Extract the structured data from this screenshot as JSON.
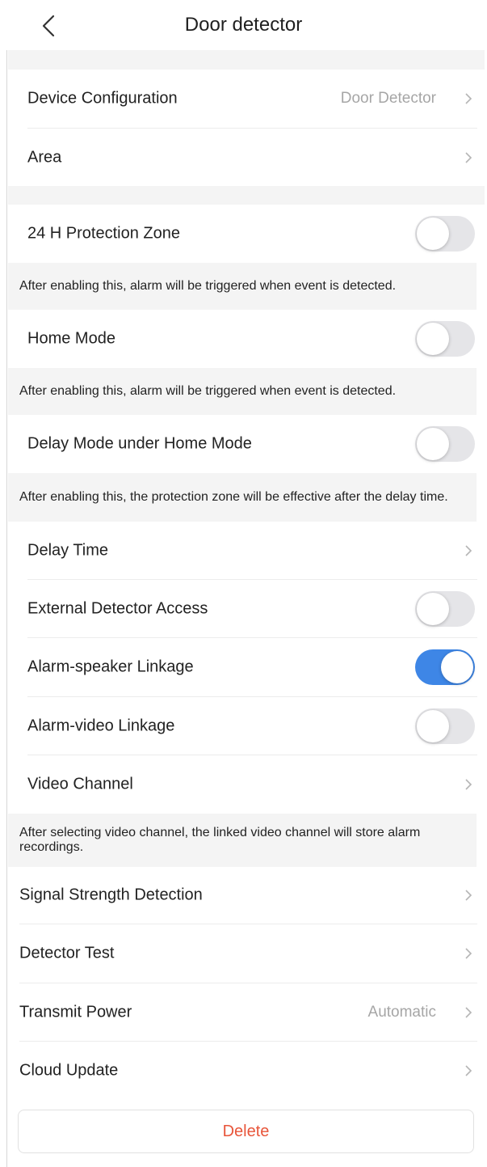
{
  "header": {
    "title": "Door detector"
  },
  "items": {
    "device_config": {
      "label": "Device Configuration",
      "value": "Door Detector"
    },
    "area": {
      "label": "Area"
    },
    "protection_24h": {
      "label": "24 H Protection Zone",
      "enabled": false
    },
    "home_mode": {
      "label": "Home Mode",
      "enabled": false
    },
    "delay_mode": {
      "label": "Delay Mode under Home Mode",
      "enabled": false
    },
    "delay_time": {
      "label": "Delay Time"
    },
    "external_detector": {
      "label": "External Detector Access",
      "enabled": false
    },
    "alarm_speaker": {
      "label": "Alarm-speaker Linkage",
      "enabled": true
    },
    "alarm_video": {
      "label": "Alarm-video Linkage",
      "enabled": false
    },
    "video_channel": {
      "label": "Video Channel"
    },
    "signal_strength": {
      "label": "Signal Strength Detection"
    },
    "detector_test": {
      "label": "Detector Test"
    },
    "transmit_power": {
      "label": "Transmit Power",
      "value": "Automatic"
    },
    "cloud_update": {
      "label": "Cloud Update"
    }
  },
  "notes": {
    "protection_24h": "After enabling this, alarm will be triggered when event is detected.",
    "home_mode": "After enabling this, alarm will be triggered when event is detected.",
    "delay_mode": "After enabling this, the protection zone will be effective after the delay time.",
    "video_channel": "After selecting video channel, the linked video channel will store alarm recordings."
  },
  "actions": {
    "delete_label": "Delete"
  },
  "colors": {
    "toggle_on": "#3e86e6",
    "toggle_off": "#e5e5e8",
    "delete_text": "#e8553a",
    "section_gap": "#f4f4f4"
  }
}
